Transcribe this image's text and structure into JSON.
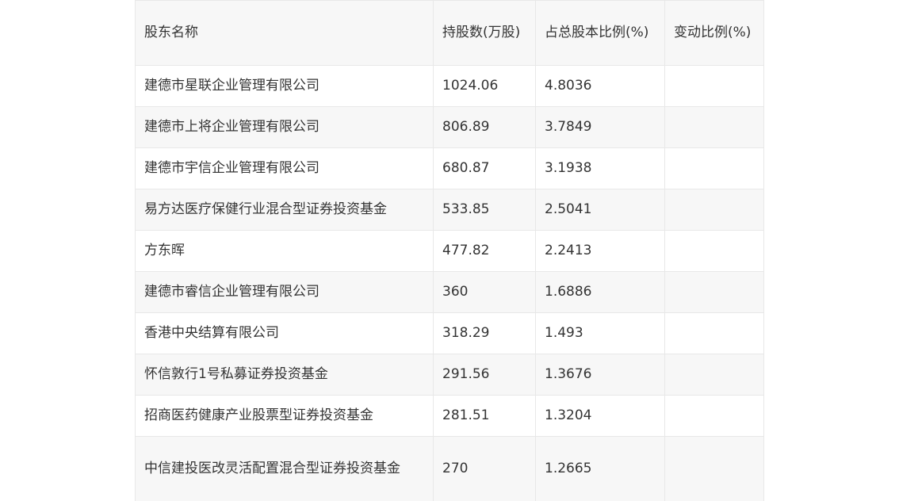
{
  "table": {
    "headers": [
      "股东名称",
      "持股数(万股)",
      "占总股本比例(%)",
      "变动比例(%)"
    ],
    "rows": [
      [
        "建德市星联企业管理有限公司",
        "1024.06",
        "4.8036",
        ""
      ],
      [
        "建德市上将企业管理有限公司",
        "806.89",
        "3.7849",
        ""
      ],
      [
        "建德市宇信企业管理有限公司",
        "680.87",
        "3.1938",
        ""
      ],
      [
        "易方达医疗保健行业混合型证券投资基金",
        "533.85",
        "2.5041",
        ""
      ],
      [
        "方东晖",
        "477.82",
        "2.2413",
        ""
      ],
      [
        "建德市睿信企业管理有限公司",
        "360",
        "1.6886",
        ""
      ],
      [
        "香港中央结算有限公司",
        "318.29",
        "1.493",
        ""
      ],
      [
        "怀信敦行1号私募证券投资基金",
        "291.56",
        "1.3676",
        ""
      ],
      [
        "招商医药健康产业股票型证券投资基金",
        "281.51",
        "1.3204",
        ""
      ],
      [
        "中信建投医改灵活配置混合型证券投资基金",
        "270",
        "1.2665",
        ""
      ]
    ]
  }
}
